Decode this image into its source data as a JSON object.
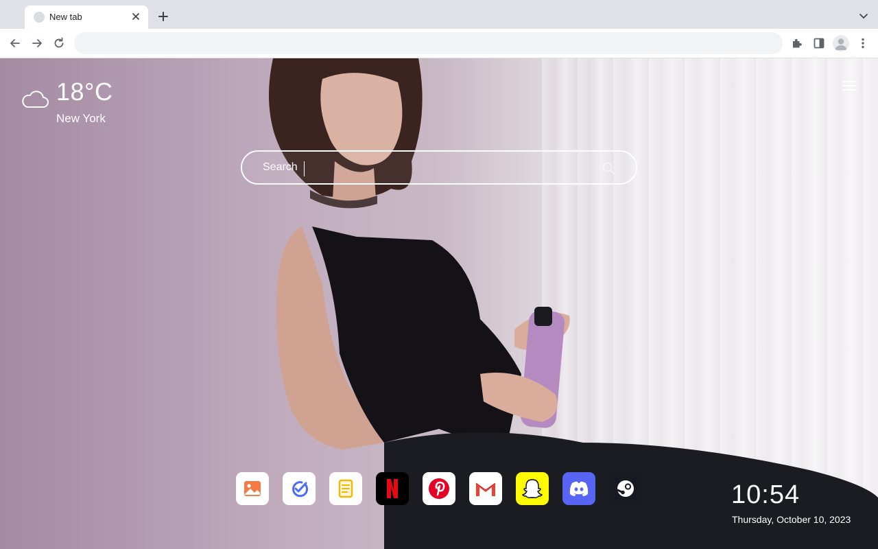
{
  "tab": {
    "title": "New tab"
  },
  "omnibox": {
    "value": ""
  },
  "weather": {
    "icon": "cloud-icon",
    "temperature": "18°C",
    "city": "New York"
  },
  "search": {
    "placeholder": "Search"
  },
  "dock": {
    "apps": [
      {
        "name": "Photos",
        "icon": "image-icon",
        "bg": "#ffffff"
      },
      {
        "name": "Tasks",
        "icon": "check-circle-icon",
        "bg": "#ffffff"
      },
      {
        "name": "Notes",
        "icon": "notes-icon",
        "bg": "#ffffff"
      },
      {
        "name": "Netflix",
        "icon": "netflix-icon",
        "bg": "#000000"
      },
      {
        "name": "Pinterest",
        "icon": "pinterest-icon",
        "bg": "#ffffff"
      },
      {
        "name": "Gmail",
        "icon": "gmail-icon",
        "bg": "#ffffff"
      },
      {
        "name": "Snapchat",
        "icon": "snapchat-icon",
        "bg": "#fffc00"
      },
      {
        "name": "Discord",
        "icon": "discord-icon",
        "bg": "#5865f2"
      },
      {
        "name": "Steam",
        "icon": "steam-icon",
        "bg": "#171a21"
      }
    ]
  },
  "clock": {
    "time": "10:54",
    "date": "Thursday, October 10, 2023"
  },
  "colors": {
    "accent": "#1a73e8",
    "netflix_red": "#e50914",
    "pinterest_red": "#e60023",
    "snapchat_yellow": "#fffc00",
    "discord_blurple": "#5865f2"
  }
}
